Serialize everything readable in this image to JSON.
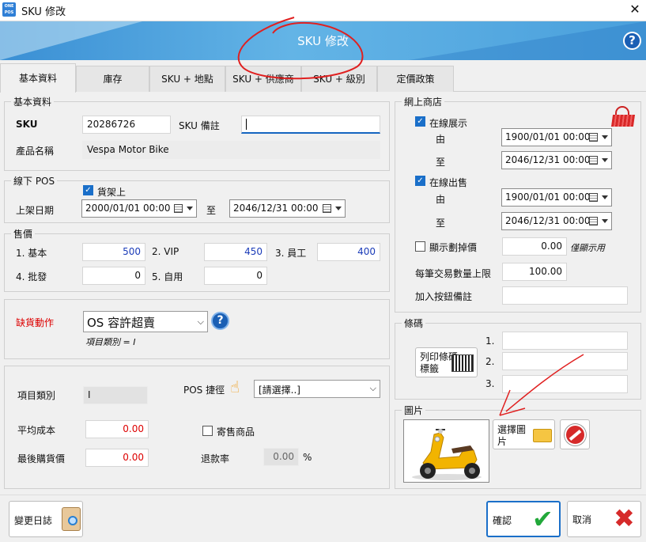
{
  "window": {
    "logo_top": "ONE",
    "logo_bottom": "POS",
    "title": "SKU 修改",
    "close": "✕"
  },
  "banner": {
    "title": "SKU 修改",
    "help": "?"
  },
  "tabs": [
    {
      "label": "基本資料"
    },
    {
      "label": "庫存"
    },
    {
      "label": "SKU + 地點"
    },
    {
      "label": "SKU + 供應商"
    },
    {
      "label": "SKU + 級別"
    },
    {
      "label": "定價政策"
    }
  ],
  "basic": {
    "group": "基本資料",
    "sku_label": "SKU",
    "sku": "20286726",
    "remark_label": "SKU 備註",
    "remark": "",
    "name_label": "產品名稱",
    "name": "Vespa Motor Bike"
  },
  "pos": {
    "group": "線下 POS",
    "shelf_label": "貨架上",
    "date_label": "上架日期",
    "from": "2000/01/01 00:00",
    "to_label": "至",
    "to": "2046/12/31 00:00"
  },
  "price": {
    "group": "售價",
    "basic_label": "1. 基本",
    "basic": "500",
    "vip_label": "2. VIP",
    "vip": "450",
    "staff_label": "3. 員工",
    "staff": "400",
    "wholesale_label": "4. 批發",
    "wholesale": "0",
    "self_label": "5. 自用",
    "self": "0"
  },
  "stockout": {
    "label": "缺貨動作",
    "value": "OS 容許超賣",
    "note": "項目類別 = I",
    "help": "?"
  },
  "item": {
    "type_label": "項目類別",
    "type": "I",
    "pos_shortcut_label": "POS 捷徑",
    "pos_shortcut": "[請選擇..]",
    "avg_cost_label": "平均成本",
    "avg_cost": "0.00",
    "consign_label": "寄售商品",
    "last_price_label": "最後購貨價",
    "last_price": "0.00",
    "refund_label": "退款率",
    "refund": "0.00",
    "refund_unit": "%"
  },
  "online": {
    "group": "網上商店",
    "show_label": "在線展示",
    "from_label": "由",
    "show_from": "1900/01/01 00:00",
    "to_label": "至",
    "show_to": "2046/12/31 00:00",
    "sell_label": "在線出售",
    "sell_from": "1900/01/01 00:00",
    "sell_to": "2046/12/31 00:00",
    "strike_label": "顯示劃掉價",
    "strike": "0.00",
    "strike_note": "僅顯示用",
    "limit_label": "每筆交易數量上限",
    "limit": "100.00",
    "note_label": "加入按鈕備註",
    "note": ""
  },
  "barcode": {
    "group": "條碼",
    "print_label": "列印條碼標籤",
    "n1": "1.",
    "n2": "2.",
    "n3": "3.",
    "b1": "",
    "b2": "",
    "b3": ""
  },
  "image": {
    "group": "圖片",
    "select_label": "選擇圖片"
  },
  "footer": {
    "log": "變更日誌",
    "ok": "確認",
    "cancel": "取消"
  },
  "colors": {
    "banner": "#4aa0dc",
    "accent": "#1a6fc9",
    "ok": "#22a83a",
    "cancel": "#d62a2a",
    "annotation": "#e02020"
  }
}
